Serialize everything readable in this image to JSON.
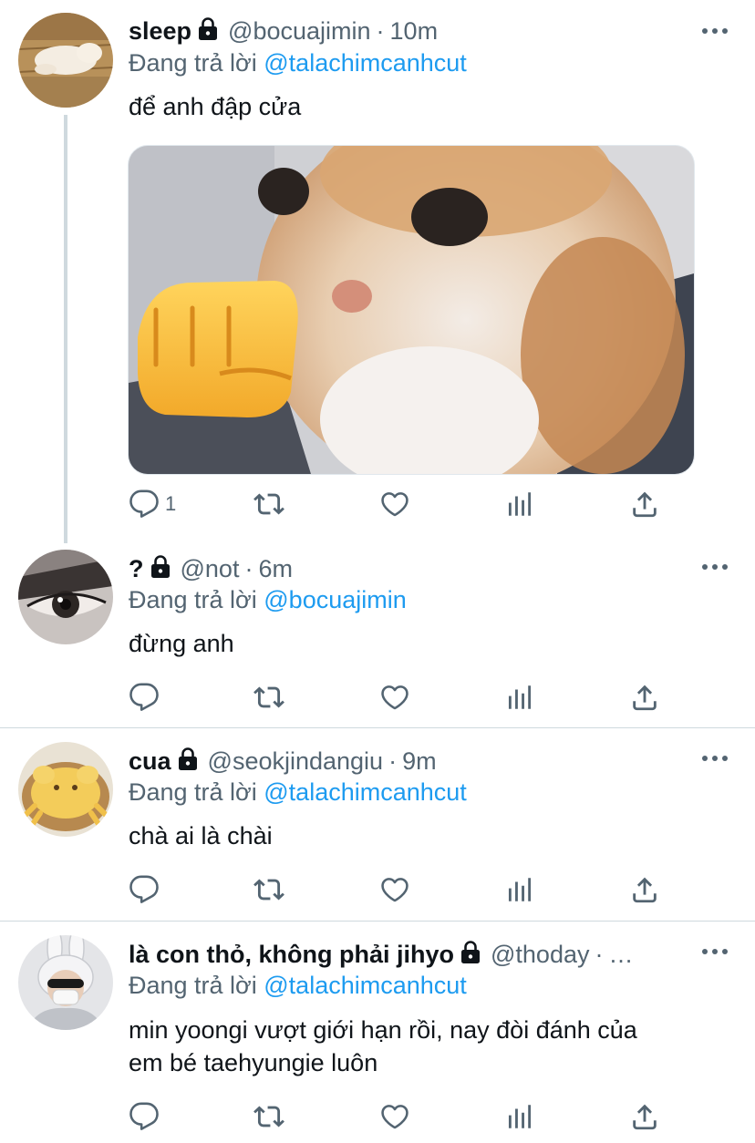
{
  "tweets": [
    {
      "name": "sleep",
      "handle": "@bocuajimin",
      "separator": "·",
      "time": "10m",
      "replying_prefix": "Đang trả lời ",
      "replying_to": "@talachimcanhcut",
      "text": "để anh đập cửa",
      "reply_count": "1",
      "avatar_icon": "avatar-sleeping-cat",
      "media_icon": "cat-punch-meme"
    },
    {
      "name": "?",
      "handle": "@not",
      "separator": "·",
      "time": "6m",
      "replying_prefix": "Đang trả lời ",
      "replying_to": "@bocuajimin",
      "text": "đừng anh",
      "reply_count": "",
      "avatar_icon": "avatar-eye-closeup"
    },
    {
      "name": "cua",
      "handle": "@seokjindangiu",
      "separator": "·",
      "time": "9m",
      "replying_prefix": "Đang trả lời ",
      "replying_to": "@talachimcanhcut",
      "text": "chà ai là chài",
      "reply_count": "",
      "avatar_icon": "avatar-crab-bread"
    },
    {
      "name": "là con thỏ, không phải jihyo",
      "handle": "@thoday",
      "separator": "·",
      "time": "…",
      "replying_prefix": "Đang trả lời ",
      "replying_to": "@talachimcanhcut",
      "text_line1": "min yoongi vượt giới hạn rồi, nay đòi đánh của",
      "text_line2": "em bé taehyungie luôn",
      "reply_count": "",
      "avatar_icon": "avatar-bunny-hat-person"
    }
  ],
  "colors": {
    "accent": "#1d9bf0",
    "secondary_text": "#536471",
    "divider": "#cfd9de"
  },
  "icons": [
    "reply-icon",
    "retweet-icon",
    "like-icon",
    "analytics-icon",
    "share-icon",
    "lock-icon",
    "more-icon"
  ]
}
